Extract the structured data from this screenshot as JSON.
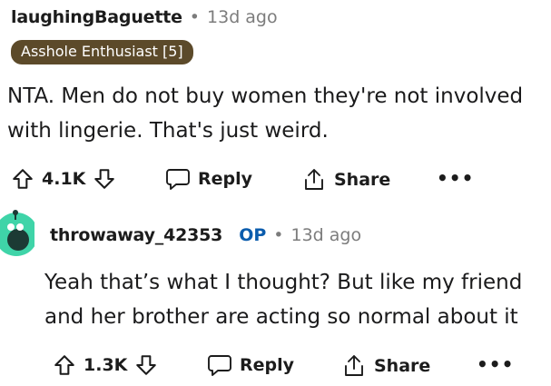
{
  "parent": {
    "username": "laughingBaguette",
    "separator": "•",
    "age": "13d ago",
    "flair": "Asshole Enthusiast [5]",
    "body_line1": "NTA. Men do not buy women they're not involved",
    "body_line2": "with lingerie. That's just weird.",
    "vote_count": "4.1K",
    "reply_label": "Reply",
    "share_label": "Share",
    "more_label": "•••"
  },
  "reply": {
    "username": "throwaway_42353",
    "op_badge": "OP",
    "separator": "•",
    "age": "13d ago",
    "body_line1": "Yeah that’s what I thought? But like my friend",
    "body_line2": "and her brother are acting so normal about it",
    "vote_count": "1.3K",
    "reply_label": "Reply",
    "share_label": "Share",
    "more_label": "•••"
  },
  "colors": {
    "flair_bg": "#5c4a2a",
    "avatar_bg": "#3fd4a8",
    "op": "#0b5cad"
  }
}
